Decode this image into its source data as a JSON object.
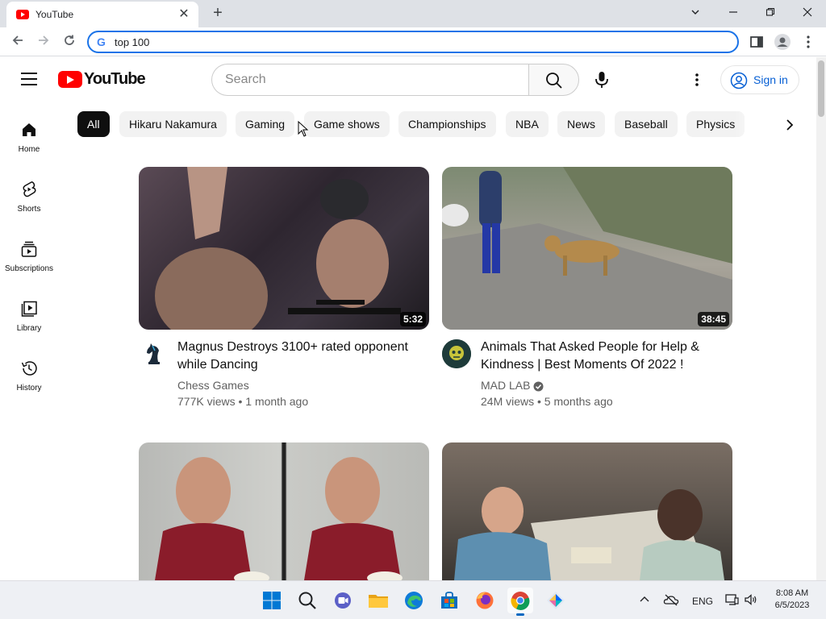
{
  "browser": {
    "tab_title": "YouTube",
    "url": "top 100"
  },
  "header": {
    "logo_text": "YouTube",
    "search_placeholder": "Search",
    "signin_label": "Sign in"
  },
  "sidebar": {
    "items": [
      {
        "label": "Home",
        "icon": "home-icon"
      },
      {
        "label": "Shorts",
        "icon": "shorts-icon"
      },
      {
        "label": "Subscriptions",
        "icon": "subscriptions-icon"
      },
      {
        "label": "Library",
        "icon": "library-icon"
      },
      {
        "label": "History",
        "icon": "history-icon"
      }
    ]
  },
  "chips": [
    "All",
    "Hikaru Nakamura",
    "Gaming",
    "Game shows",
    "Championships",
    "NBA",
    "News",
    "Baseball",
    "Physics"
  ],
  "videos": [
    {
      "title_line1": "Magnus Destroys 3100+ rated opponent",
      "title_line2": "while Dancing",
      "channel": "Chess Games",
      "meta": "777K views • 1 month ago",
      "duration": "5:32",
      "verified": false
    },
    {
      "title_line1": "Animals That Asked People for Help &",
      "title_line2": "Kindness | Best Moments Of 2022 !",
      "channel": "MAD LAB",
      "meta": "24M views • 5 months ago",
      "duration": "38:45",
      "verified": true
    }
  ],
  "taskbar": {
    "language": "ENG",
    "time": "8:08 AM",
    "date": "6/5/2023"
  },
  "colors": {
    "brand_red": "#ff0000",
    "link_blue": "#065fd4",
    "omnibox_focus": "#1a73e8"
  }
}
